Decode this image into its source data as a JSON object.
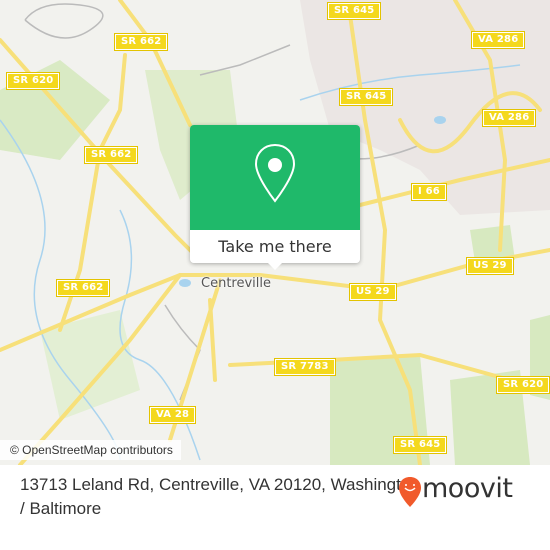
{
  "map": {
    "town_label": "Centreville",
    "road_shields": [
      {
        "label": "SR 662",
        "id": "sr662-north"
      },
      {
        "label": "SR 620",
        "id": "sr620-west"
      },
      {
        "label": "SR 662",
        "id": "sr662-mid"
      },
      {
        "label": "SR 645",
        "id": "sr645-top"
      },
      {
        "label": "VA 286",
        "id": "va286-top"
      },
      {
        "label": "SR 645",
        "id": "sr645-mid"
      },
      {
        "label": "VA 286",
        "id": "va286-mid"
      },
      {
        "label": "I 66",
        "id": "i66"
      },
      {
        "label": "US 29",
        "id": "us29-east"
      },
      {
        "label": "US 29",
        "id": "us29-mid"
      },
      {
        "label": "SR 662",
        "id": "sr662-south"
      },
      {
        "label": "SR 7783",
        "id": "sr7783"
      },
      {
        "label": "SR 620",
        "id": "sr620-east"
      },
      {
        "label": "VA 28",
        "id": "va28"
      },
      {
        "label": "SR 645",
        "id": "sr645-south"
      }
    ],
    "attribution": "© OpenStreetMap contributors",
    "colors": {
      "background": "#f2f2ee",
      "park": "#d7e9c0",
      "road": "#f7e27c",
      "water": "#a9d3ee",
      "residential": "#e8e2e0"
    }
  },
  "popup": {
    "icon": "map-pin-icon",
    "button_label": "Take me there",
    "color": "#1fb96a"
  },
  "footer": {
    "address": "13713 Leland Rd, Centreville, VA 20120, Washington / Baltimore",
    "brand": "moovit",
    "brand_icon": "moovit-pin-icon",
    "brand_color": "#f15a2b"
  }
}
